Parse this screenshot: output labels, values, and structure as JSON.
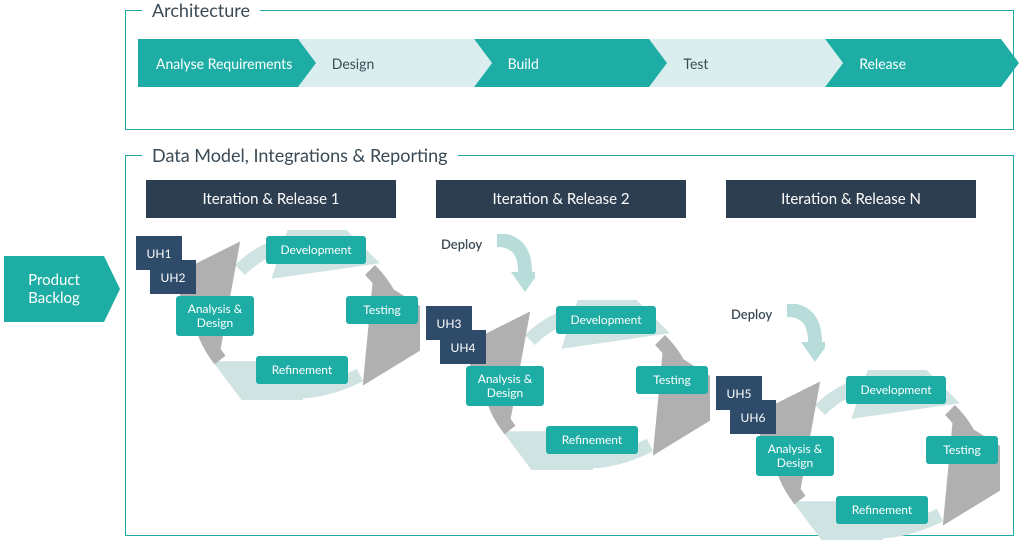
{
  "architecture": {
    "title": "Architecture",
    "stages": [
      "Analyse Requirements",
      "Design",
      "Build",
      "Test",
      "Release"
    ]
  },
  "backlog_label_line1": "Product",
  "backlog_label_line2": "Backlog",
  "section_title": "Data Model, Integrations & Reporting",
  "iterations": {
    "it1": "Iteration & Release 1",
    "it2": "Iteration & Release 2",
    "it3": "Iteration & Release N"
  },
  "uh": {
    "u1": "UH1",
    "u2": "UH2",
    "u3": "UH3",
    "u4": "UH4",
    "u5": "UH5",
    "u6": "UH6"
  },
  "cycle_stages": {
    "analysis_design": "Analysis & Design",
    "development": "Development",
    "testing": "Testing",
    "refinement": "Refinement"
  },
  "deploy_label": "Deploy"
}
